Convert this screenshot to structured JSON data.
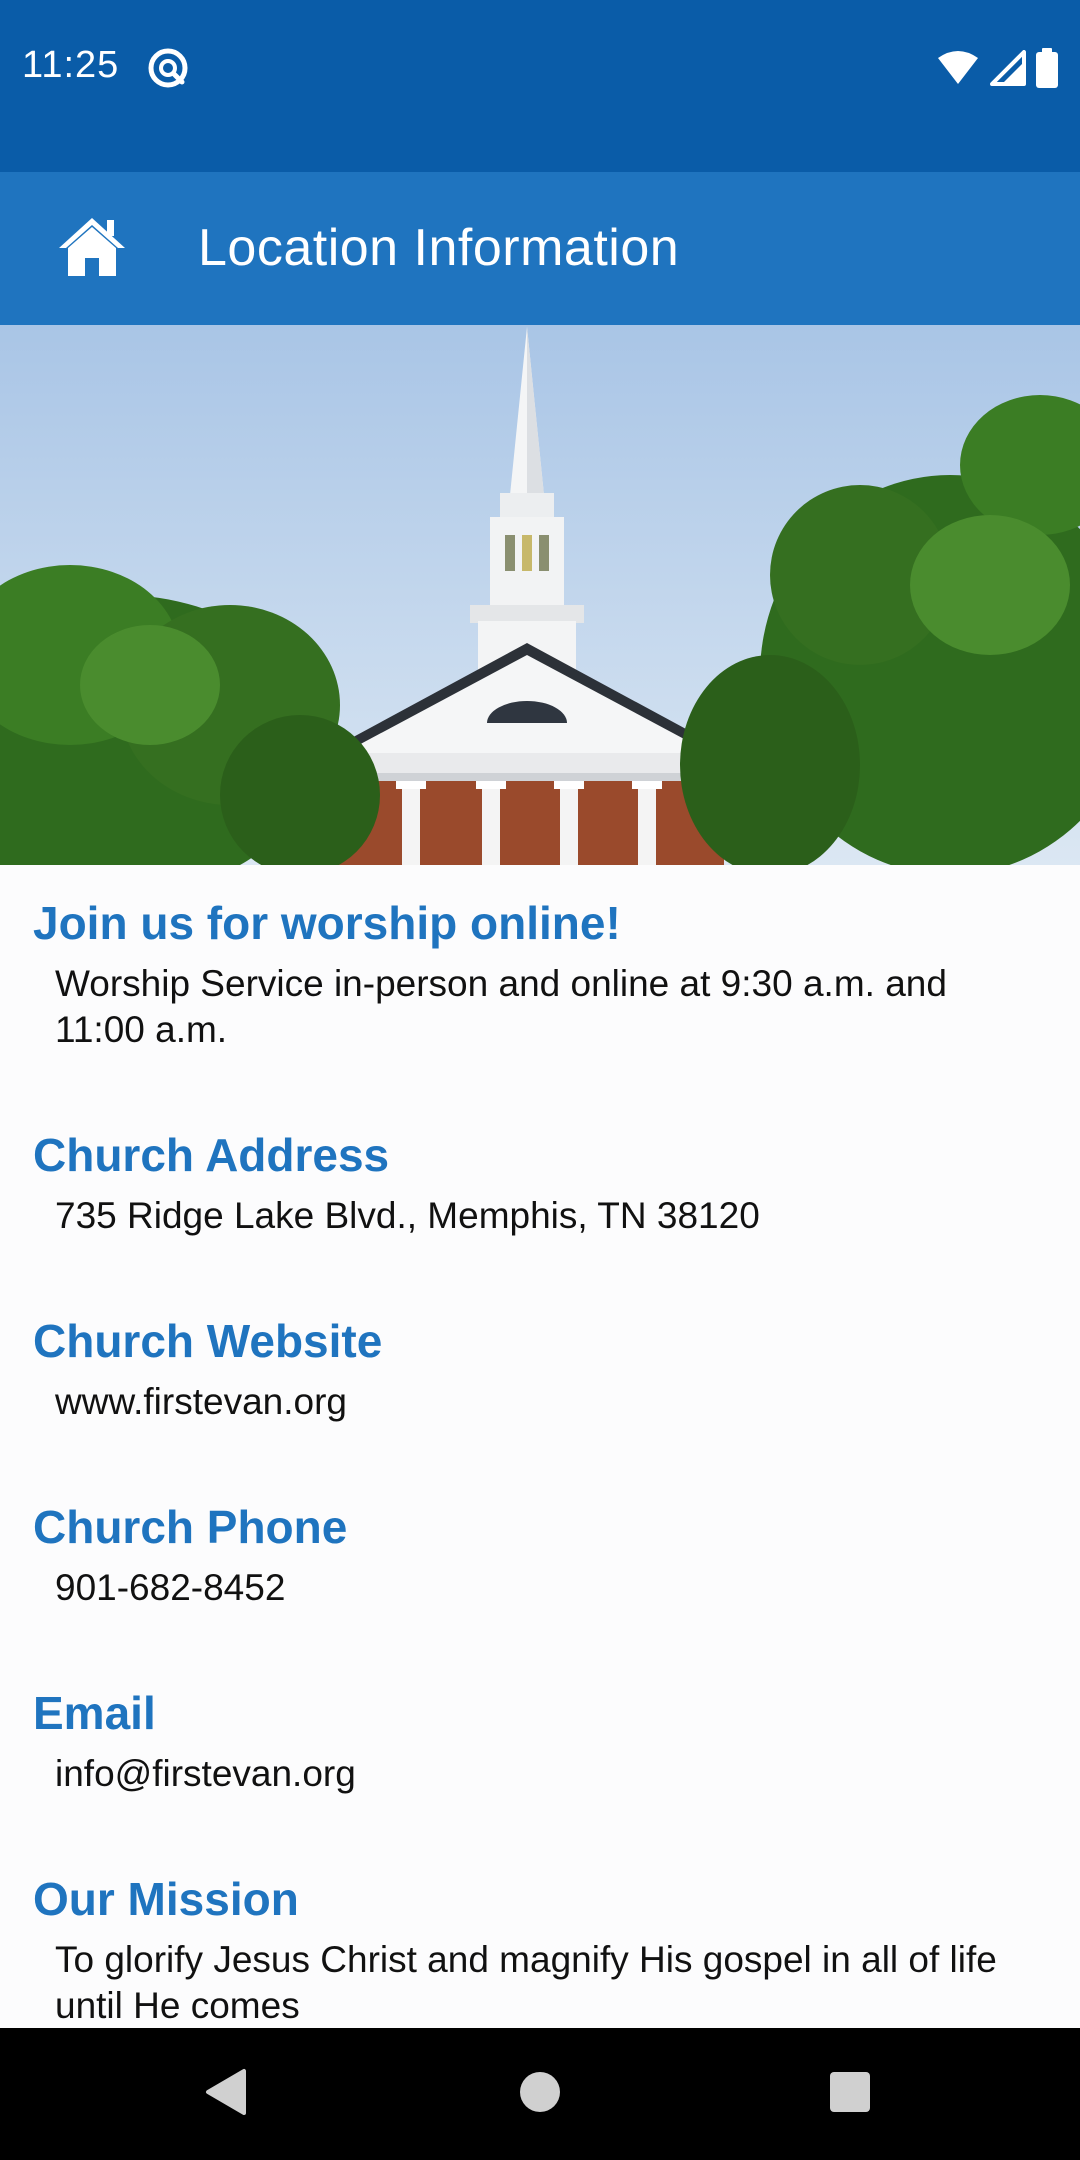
{
  "status_bar": {
    "time": "11:25",
    "icons": [
      "at-sign-icon",
      "wifi-icon",
      "signal-icon",
      "battery-icon"
    ]
  },
  "app_bar": {
    "title": "Location Information",
    "home_icon": "home-icon",
    "color": "#1f74bf"
  },
  "hero_image": "church-steeple-photo",
  "sections": [
    {
      "title": "Join us for worship online!",
      "body": "Worship Service in-person and online at 9:30 a.m. and 11:00 a.m."
    },
    {
      "title": "Church Address",
      "body": "735 Ridge Lake Blvd., Memphis, TN 38120"
    },
    {
      "title": "Church Website",
      "body": "www.firstevan.org"
    },
    {
      "title": "Church Phone",
      "body": "901-682-8452"
    },
    {
      "title": "Email",
      "body": "info@firstevan.org"
    },
    {
      "title": "Our Mission",
      "body": "To glorify Jesus Christ and magnify His gospel in all of life until He comes"
    }
  ],
  "nav_bar": {
    "buttons": [
      "back-icon",
      "home-circle-icon",
      "recents-icon"
    ]
  },
  "colors": {
    "status_bar": "#0a5ca8",
    "accent": "#1f74bf",
    "text": "#111111"
  }
}
